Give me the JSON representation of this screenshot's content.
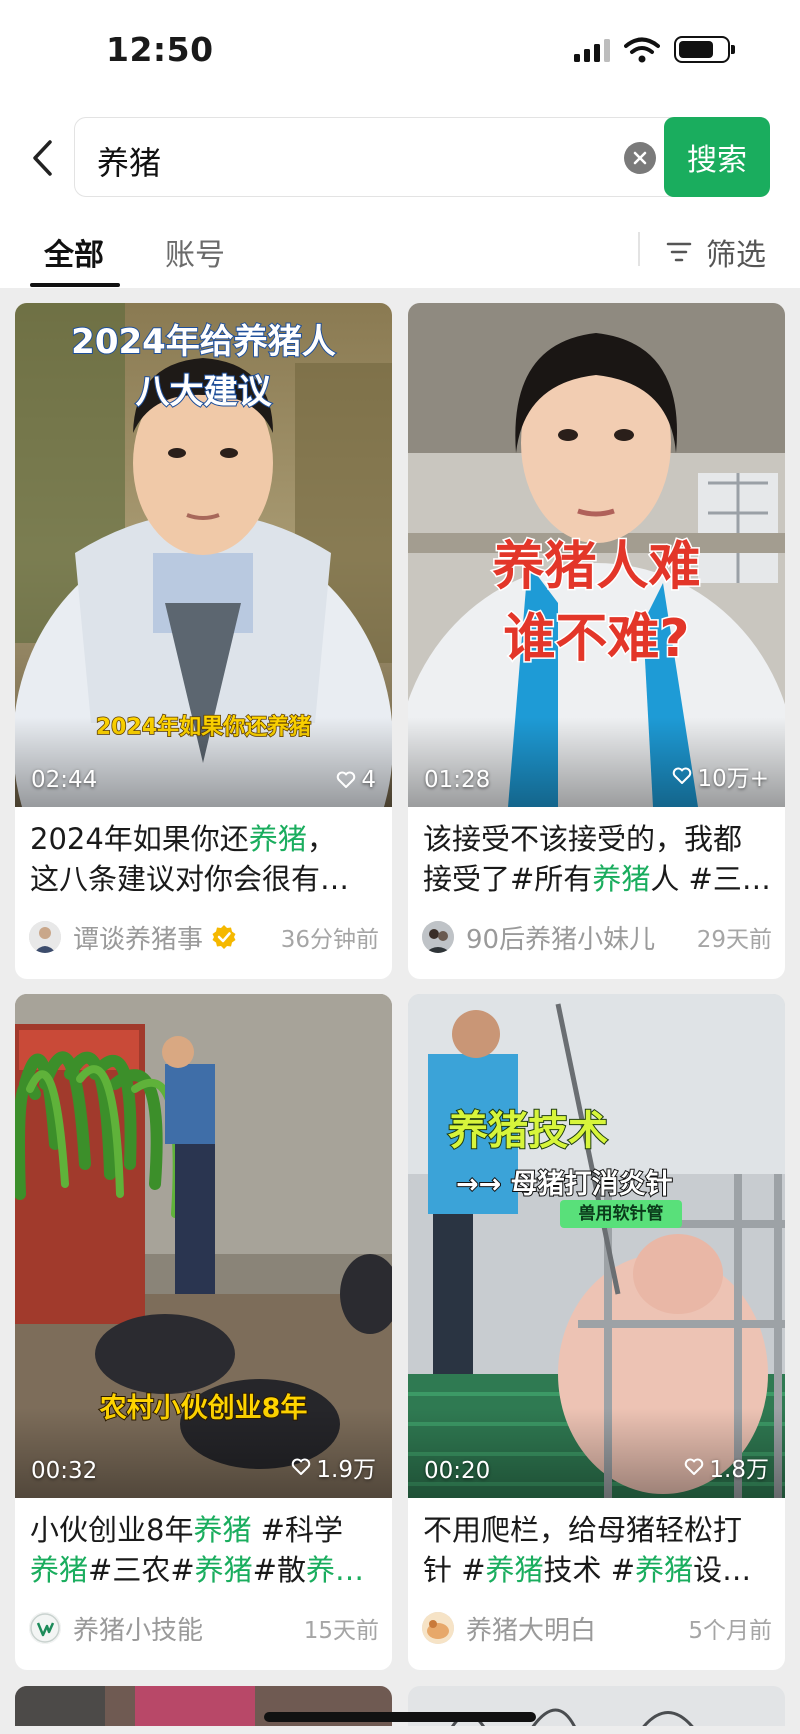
{
  "status_bar": {
    "time": "12:50"
  },
  "search": {
    "query": "养猪",
    "button_label": "搜索"
  },
  "tabs": {
    "all": "全部",
    "account": "账号",
    "filter": "筛选"
  },
  "cards": [
    {
      "overlay_line1": "2024年给养猪人",
      "overlay_line2": "八大建议",
      "overlay_caption": "2024年如果你还养猪",
      "duration": "02:44",
      "likes": "4",
      "desc_line1_a": "2024年如果你还",
      "desc_line1_hl": "养猪",
      "desc_line1_b": "，",
      "desc_line2": "这八条建议对你会很有…",
      "author": "谭谈养猪事",
      "time": "36分钟前"
    },
    {
      "overlay_line1": "养猪人难",
      "overlay_line2": "谁不难?",
      "duration": "01:28",
      "likes": "10万+",
      "desc_line1": "该接受不该接受的，我都",
      "desc_line2_a": "接受了#所有",
      "desc_line2_hl": "养猪",
      "desc_line2_b": "人 #三…",
      "author": "90后养猪小妹儿",
      "time": "29天前"
    },
    {
      "overlay_caption": "农村小伙创业8年",
      "duration": "00:32",
      "likes": "1.9万",
      "desc_line1_a": "小伙创业8年",
      "desc_line1_hl": "养猪",
      "desc_line1_b": " #科学",
      "desc_line2_hl1": "养猪",
      "desc_line2_a": "#三农#",
      "desc_line2_hl2": "养猪",
      "desc_line2_b": "#散",
      "desc_line2_hl3": "养…",
      "author": "养猪小技能",
      "time": "15天前"
    },
    {
      "overlay_line1": "养猪技术",
      "overlay_line2": "→→ 母猪打消炎针",
      "overlay_tag": "兽用软针管",
      "duration": "00:20",
      "likes": "1.8万",
      "desc_line1": "不用爬栏，给母猪轻松打",
      "desc_line2_a": "针 #",
      "desc_line2_hl1": "养猪",
      "desc_line2_b": "技术 #",
      "desc_line2_hl2": "养猪",
      "desc_line2_c": "设…",
      "author": "养猪大明白",
      "time": "5个月前"
    }
  ],
  "colors": {
    "accent": "#1aad5e",
    "verified": "#f5b800"
  }
}
